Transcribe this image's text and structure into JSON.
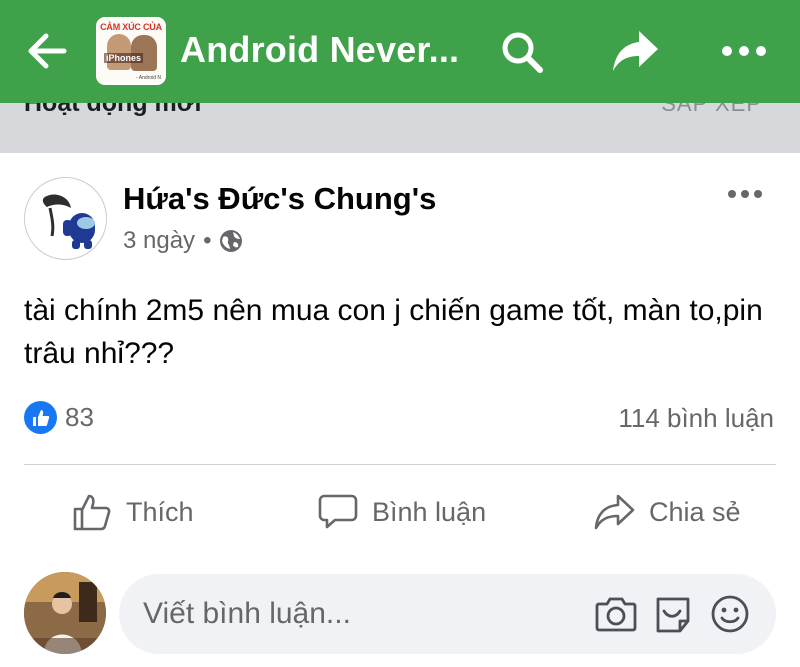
{
  "appbar": {
    "title": "Android Never...",
    "thumb_title": "CẢM XÚC CỦA",
    "thumb_label": "iPhones",
    "thumb_small": "- Android N",
    "back_icon": "arrow-left-icon",
    "search_icon": "search-icon",
    "share_icon": "share-arrow-icon",
    "more_icon": "more-dots-icon",
    "color": "#3fa14a"
  },
  "sub_strip": {
    "left_text": "Hoạt động mới",
    "right_text": "SẮP XẾP"
  },
  "post": {
    "author": "Hứa's Đức's Chung's",
    "time": "3 ngày",
    "separator": "•",
    "privacy_icon": "globe-icon",
    "text": "tài chính 2m5 nên mua con j chiến game tốt, màn to,pin trâu nhỉ???",
    "like_count": "83",
    "comment_count": "114 bình luận",
    "actions": {
      "like": "Thích",
      "comment": "Bình luận",
      "share": "Chia sẻ"
    },
    "like_color": "#1877f2"
  },
  "comment_composer": {
    "placeholder": "Viết bình luận...",
    "camera_icon": "camera-icon",
    "sticker_icon": "sticker-icon",
    "emoji_icon": "emoji-icon"
  }
}
